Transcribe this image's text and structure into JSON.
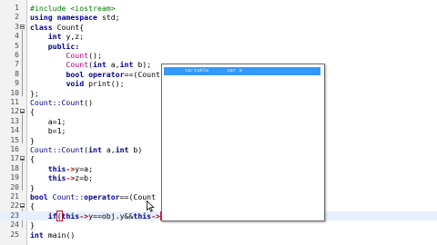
{
  "editor": {
    "lines": [
      {
        "n": "1",
        "parts": [
          {
            "c": "pp",
            "t": "#include <iostream>"
          }
        ]
      },
      {
        "n": "2",
        "parts": [
          {
            "c": "kw",
            "t": "using namespace"
          },
          {
            "c": "tx",
            "t": " std;"
          }
        ]
      },
      {
        "n": "3",
        "parts": [
          {
            "c": "kw",
            "t": "class"
          },
          {
            "c": "tx",
            "t": " Count{"
          }
        ]
      },
      {
        "n": "4",
        "parts": [
          {
            "c": "tx",
            "t": "    "
          },
          {
            "c": "kw",
            "t": "int"
          },
          {
            "c": "tx",
            "t": " y,z;"
          }
        ]
      },
      {
        "n": "5",
        "parts": [
          {
            "c": "tx",
            "t": "    "
          },
          {
            "c": "kw",
            "t": "public:"
          }
        ]
      },
      {
        "n": "6",
        "parts": [
          {
            "c": "tx",
            "t": "        "
          },
          {
            "c": "nm",
            "t": "Count"
          },
          {
            "c": "tx",
            "t": "();"
          }
        ]
      },
      {
        "n": "7",
        "parts": [
          {
            "c": "tx",
            "t": "        "
          },
          {
            "c": "nm",
            "t": "Count"
          },
          {
            "c": "tx",
            "t": "("
          },
          {
            "c": "kw",
            "t": "int"
          },
          {
            "c": "tx",
            "t": " a,"
          },
          {
            "c": "kw",
            "t": "int"
          },
          {
            "c": "tx",
            "t": " b);"
          }
        ]
      },
      {
        "n": "8",
        "parts": [
          {
            "c": "tx",
            "t": "        "
          },
          {
            "c": "kw",
            "t": "bool"
          },
          {
            "c": "tx",
            "t": " "
          },
          {
            "c": "kw",
            "t": "operator"
          },
          {
            "c": "tx",
            "t": "==(Count"
          }
        ]
      },
      {
        "n": "9",
        "parts": [
          {
            "c": "tx",
            "t": "        "
          },
          {
            "c": "kw",
            "t": "void"
          },
          {
            "c": "tx",
            "t": " print();"
          }
        ]
      },
      {
        "n": "10",
        "parts": [
          {
            "c": "tx",
            "t": "};"
          }
        ]
      },
      {
        "n": "11",
        "parts": [
          {
            "c": "cl",
            "t": "Count::Count"
          },
          {
            "c": "tx",
            "t": "()"
          }
        ]
      },
      {
        "n": "12",
        "parts": [
          {
            "c": "tx",
            "t": "{"
          }
        ]
      },
      {
        "n": "13",
        "parts": [
          {
            "c": "tx",
            "t": "    a=1;"
          }
        ]
      },
      {
        "n": "14",
        "parts": [
          {
            "c": "tx",
            "t": "    b=1;"
          }
        ]
      },
      {
        "n": "15",
        "parts": [
          {
            "c": "tx",
            "t": "}"
          }
        ]
      },
      {
        "n": "16",
        "parts": [
          {
            "c": "cl",
            "t": "Count::Count"
          },
          {
            "c": "tx",
            "t": "("
          },
          {
            "c": "kw",
            "t": "int"
          },
          {
            "c": "tx",
            "t": " a,"
          },
          {
            "c": "kw",
            "t": "int"
          },
          {
            "c": "tx",
            "t": " b)"
          }
        ]
      },
      {
        "n": "17",
        "parts": [
          {
            "c": "tx",
            "t": "{"
          }
        ]
      },
      {
        "n": "18",
        "parts": [
          {
            "c": "tx",
            "t": "    "
          },
          {
            "c": "kw",
            "t": "this"
          },
          {
            "c": "op",
            "t": "->"
          },
          {
            "c": "tx",
            "t": "y=a;"
          }
        ]
      },
      {
        "n": "19",
        "parts": [
          {
            "c": "tx",
            "t": "    "
          },
          {
            "c": "kw",
            "t": "this"
          },
          {
            "c": "op",
            "t": "->"
          },
          {
            "c": "tx",
            "t": "z=b;"
          }
        ]
      },
      {
        "n": "20",
        "parts": [
          {
            "c": "tx",
            "t": "}"
          }
        ]
      },
      {
        "n": "21",
        "parts": [
          {
            "c": "kw",
            "t": "bool"
          },
          {
            "c": "tx",
            "t": " "
          },
          {
            "c": "cl",
            "t": "Count::"
          },
          {
            "c": "kw",
            "t": "operator"
          },
          {
            "c": "tx",
            "t": "==(Count"
          }
        ]
      },
      {
        "n": "22",
        "parts": [
          {
            "c": "tx",
            "t": "{"
          }
        ]
      },
      {
        "n": "23",
        "parts": [
          {
            "c": "tx",
            "t": "    "
          },
          {
            "c": "kw",
            "t": "if"
          },
          {
            "c": "b1",
            "t": "("
          },
          {
            "c": "kw",
            "t": "this"
          },
          {
            "c": "op",
            "t": "->"
          },
          {
            "c": "tx",
            "t": "y==obj.y&&"
          },
          {
            "c": "kw",
            "t": "this"
          },
          {
            "c": "op",
            "t": "->"
          },
          {
            "c": "b2",
            "t": ")"
          }
        ]
      },
      {
        "n": "24",
        "parts": [
          {
            "c": "tx",
            "t": "}"
          }
        ]
      },
      {
        "n": "25",
        "parts": [
          {
            "c": "kw",
            "t": "int"
          },
          {
            "c": "tx",
            "t": " main()"
          }
        ]
      }
    ]
  },
  "autocomplete": {
    "selected_item": "      variable      var a"
  }
}
